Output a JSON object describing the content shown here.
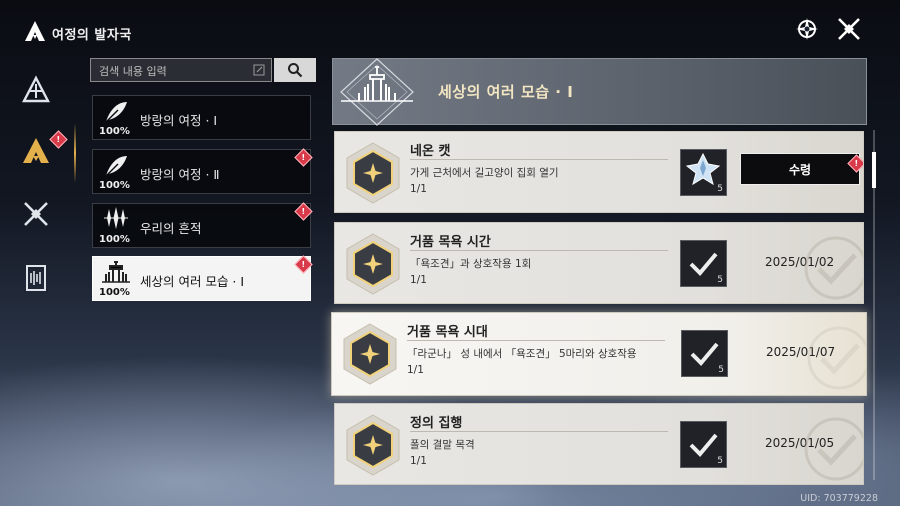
{
  "header": {
    "title": "여정의 발자국"
  },
  "search": {
    "placeholder": "검색 내용 입력"
  },
  "categories": [
    {
      "name": "방랑의 여정 · Ⅰ",
      "percent": "100%",
      "icon": "feather-icon",
      "badge": false,
      "active": false
    },
    {
      "name": "방랑의 여정 · Ⅱ",
      "percent": "100%",
      "icon": "feather-icon",
      "badge": true,
      "active": false
    },
    {
      "name": "우리의 흔적",
      "percent": "100%",
      "icon": "sparkles-icon",
      "badge": true,
      "active": false
    },
    {
      "name": "세상의 여러 모습 · Ⅰ",
      "percent": "100%",
      "icon": "city-skyline-icon",
      "badge": true,
      "active": true
    }
  ],
  "panel": {
    "title": "세상의 여러 모습 · Ⅰ"
  },
  "achievements": [
    {
      "title": "네온 캣",
      "desc": "가게 근처에서 길고양이 집회 열기",
      "progress": "1/1",
      "reward_count": "5",
      "status": "claimable",
      "claim_label": "수령",
      "date": ""
    },
    {
      "title": "거품 목욕 시간",
      "desc": "「욕조견」과 상호작용 1회",
      "progress": "1/1",
      "reward_count": "5",
      "status": "claimed",
      "claim_label": "",
      "date": "2025/01/02"
    },
    {
      "title": "거품 목욕 시대",
      "desc": "「라군나」 성 내에서 「욕조견」 5마리와 상호작용",
      "progress": "1/1",
      "reward_count": "5",
      "status": "claimed",
      "claim_label": "",
      "date": "2025/01/07"
    },
    {
      "title": "정의 집행",
      "desc": "폴의 결말 목격",
      "progress": "1/1",
      "reward_count": "5",
      "status": "claimed",
      "claim_label": "",
      "date": "2025/01/05"
    }
  ],
  "footer": {
    "uid": "UID: 703779228"
  },
  "colors": {
    "accent_gold": "#e4b04c",
    "badge_red": "#d83a4a",
    "hex_gold": "#f1d27a"
  }
}
